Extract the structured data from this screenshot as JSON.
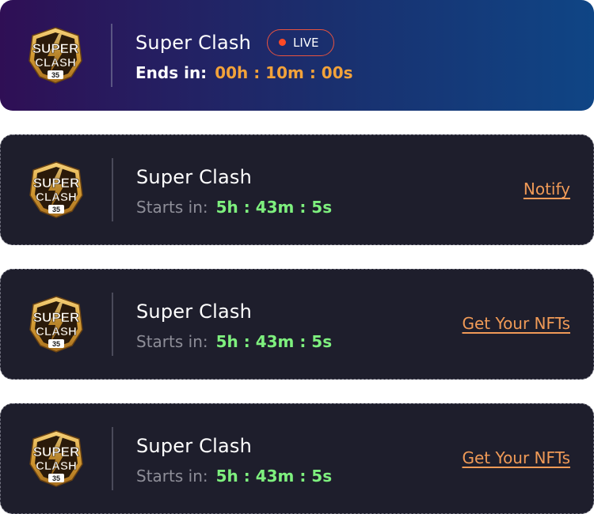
{
  "cards": [
    {
      "title": "Super Clash",
      "badge": "LIVE",
      "time_label": "Ends in:",
      "time_value": "00h : 10m : 00s",
      "action": ""
    },
    {
      "title": "Super Clash",
      "time_label": "Starts in:",
      "time_value": "5h : 43m : 5s",
      "action": "Notify"
    },
    {
      "title": "Super Clash",
      "time_label": "Starts in:",
      "time_value": "5h : 43m : 5s",
      "action": "Get Your NFTs"
    },
    {
      "title": "Super Clash",
      "time_label": "Starts in:",
      "time_value": "5h : 43m : 5s",
      "action": "Get Your NFTs"
    }
  ],
  "logo": {
    "text_top": "SUPER",
    "text_bottom": "CLASH",
    "number": "35"
  },
  "colors": {
    "ends_timer": "#f2a23a",
    "starts_timer": "#7ef07e",
    "action_link": "#f09a57",
    "live_dot": "#ff4a26"
  },
  "icons": {
    "logo": "super-clash-logo",
    "live_indicator": "live-dot-icon"
  }
}
